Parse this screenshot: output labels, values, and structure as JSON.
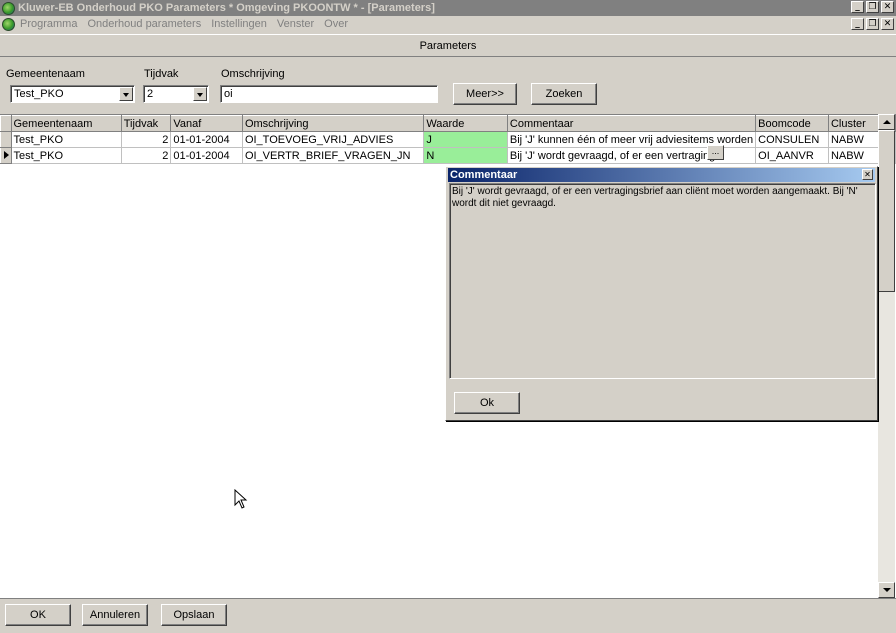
{
  "window": {
    "title": "Kluwer-EB Onderhoud PKO Parameters * Omgeving PKOONTW * - [Parameters]",
    "min_glyph": "_",
    "max_glyph": "❐",
    "close_glyph": "✕"
  },
  "menu": {
    "items": [
      "Programma",
      "Onderhoud parameters",
      "Instellingen",
      "Venster",
      "Over"
    ]
  },
  "caption": "Parameters",
  "filter": {
    "gemeentenaam_label": "Gemeentenaam",
    "gemeentenaam_value": "Test_PKO",
    "tijdvak_label": "Tijdvak",
    "tijdvak_value": "2",
    "omschrijving_label": "Omschrijving",
    "omschrijving_value": "oi",
    "meer_button": "Meer>>",
    "zoeken_button": "Zoeken"
  },
  "grid": {
    "columns": [
      "Gemeentenaam",
      "Tijdvak",
      "Vanaf",
      "Omschrijving",
      "Waarde",
      "Commentaar",
      "Boomcode",
      "Cluster"
    ],
    "rows": [
      [
        "Test_PKO",
        "2",
        "01-01-2004",
        "OI_TOEVOEG_VRIJ_ADVIES",
        "J",
        "Bij 'J' kunnen één of meer vrij adviesitems worden",
        "CONSULEN",
        "NABW"
      ],
      [
        "Test_PKO",
        "2",
        "01-01-2004",
        "OI_VERTR_BRIEF_VRAGEN_JN",
        "N",
        "Bij 'J' wordt gevraagd, of er een vertraging",
        "OI_AANVR",
        "NABW"
      ]
    ],
    "ellipsis": "..."
  },
  "popup": {
    "title": "Commentaar",
    "close_glyph": "✕",
    "text": "Bij 'J' wordt gevraagd, of er een vertragingsbrief aan cliënt moet worden aangemaakt. Bij 'N' wordt dit niet gevraagd.",
    "ok_button": "Ok"
  },
  "bottom": {
    "ok_button": "OK",
    "annuleren_button": "Annuleren",
    "opslaan_button": "Opslaan"
  }
}
